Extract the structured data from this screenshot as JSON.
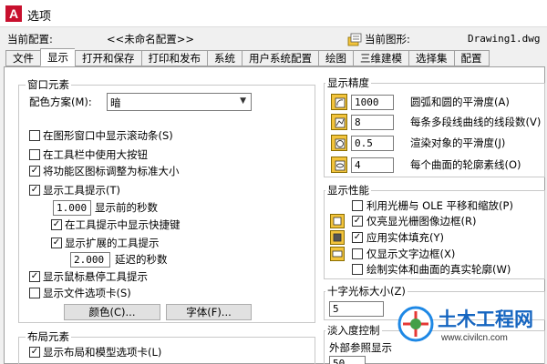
{
  "window": {
    "title": "选项"
  },
  "config": {
    "current_profile_label": "当前配置:",
    "current_profile_value": "<<未命名配置>>",
    "current_drawing_label": "当前图形:",
    "current_drawing_value": "Drawing1.dwg"
  },
  "tabs": [
    "文件",
    "显示",
    "打开和保存",
    "打印和发布",
    "系统",
    "用户系统配置",
    "绘图",
    "三维建模",
    "选择集",
    "配置"
  ],
  "active_tab": "显示",
  "window_elements": {
    "title": "窗口元素",
    "color_scheme_label": "配色方案(M):",
    "color_scheme_value": "暗",
    "checkboxes": [
      {
        "label": "在图形窗口中显示滚动条(S)",
        "checked": false
      },
      {
        "label": "在工具栏中使用大按钮",
        "checked": false
      },
      {
        "label": "将功能区图标调整为标准大小",
        "checked": true
      },
      {
        "label": "显示工具提示(T)",
        "checked": true
      }
    ],
    "tooltip_delay_value": "1.000",
    "tooltip_delay_label": "显示前的秒数",
    "show_shortcut_label": "在工具提示中显示快捷键",
    "show_shortcut_checked": true,
    "show_extended_label": "显示扩展的工具提示",
    "show_extended_checked": true,
    "extended_delay_value": "2.000",
    "extended_delay_label": "延迟的秒数",
    "rollover_label": "显示鼠标悬停工具提示",
    "rollover_checked": true,
    "file_tabs_label": "显示文件选项卡(S)",
    "file_tabs_checked": false,
    "colors_button": "颜色(C)...",
    "fonts_button": "字体(F)..."
  },
  "layout_elements": {
    "title": "布局元素",
    "first_checkbox_label": "显示布局和模型选项卡(L)",
    "first_checkbox_checked": true
  },
  "display_resolution": {
    "title": "显示精度",
    "rows": [
      {
        "value": "1000",
        "label": "圆弧和圆的平滑度(A)"
      },
      {
        "value": "8",
        "label": "每条多段线曲线的线段数(V)"
      },
      {
        "value": "0.5",
        "label": "渲染对象的平滑度(J)"
      },
      {
        "value": "4",
        "label": "每个曲面的轮廓素线(O)"
      }
    ]
  },
  "display_performance": {
    "title": "显示性能",
    "items": [
      {
        "label": "利用光栅与 OLE 平移和缩放(P)",
        "checked": false,
        "has_icon": false
      },
      {
        "label": "仅亮显光栅图像边框(R)",
        "checked": true,
        "has_icon": true
      },
      {
        "label": "应用实体填充(Y)",
        "checked": true,
        "has_icon": true
      },
      {
        "label": "仅显示文字边框(X)",
        "checked": false,
        "has_icon": true
      },
      {
        "label": "绘制实体和曲面的真实轮廓(W)",
        "checked": false,
        "has_icon": false
      }
    ]
  },
  "crosshair": {
    "title": "十字光标大小(Z)",
    "value": "5"
  },
  "fade_control": {
    "title": "淡入度控制",
    "xref_label": "外部参照显示",
    "xref_value": "50"
  },
  "watermark": {
    "brand": "土木工程网",
    "url": "www.civilcn.com"
  },
  "colors": {
    "accent": "#c8102e",
    "icon_yellow": "#f3c43c",
    "check": "#1e5bb5"
  }
}
